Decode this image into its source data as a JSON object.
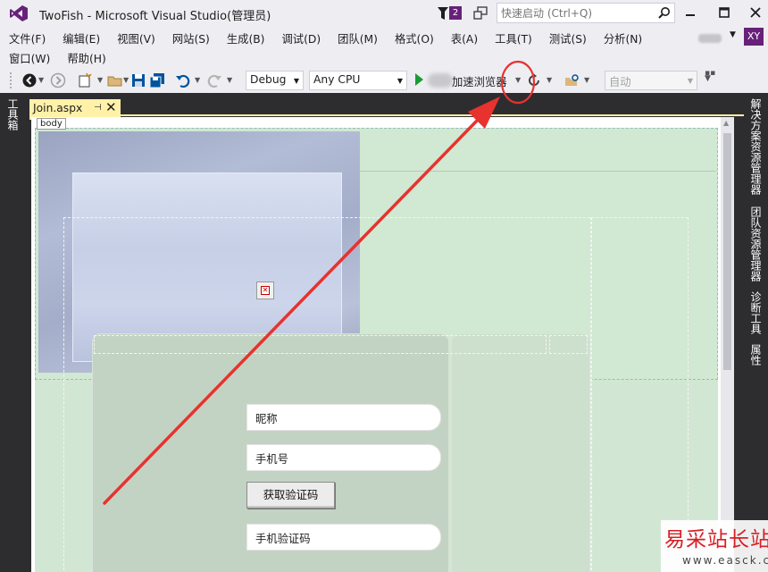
{
  "window": {
    "title": "TwoFish - Microsoft Visual Studio(管理员)",
    "notification_count": "2",
    "quick_launch_placeholder": "快速启动 (Ctrl+Q)",
    "user_initials": "XY"
  },
  "menu": {
    "row1": [
      "文件(F)",
      "编辑(E)",
      "视图(V)",
      "网站(S)",
      "生成(B)",
      "调试(D)",
      "团队(M)",
      "格式(O)",
      "表(A)",
      "工具(T)",
      "测试(S)",
      "分析(N)"
    ],
    "row2": [
      "窗口(W)",
      "帮助(H)"
    ]
  },
  "toolbar": {
    "config": "Debug",
    "platform": "Any CPU",
    "start_label": "加速浏览器",
    "disabled_combo": "自动"
  },
  "left_dock": {
    "toolbox": "工具箱"
  },
  "right_dock": {
    "tabs": [
      "解决方案资源管理器",
      "团队资源管理器",
      "诊断工具",
      "属性"
    ]
  },
  "editor": {
    "tab_title": "Join.aspx",
    "breadcrumb_tag": "body"
  },
  "form": {
    "nickname": "昵称",
    "phone": "手机号",
    "get_code_button": "获取验证码",
    "code": "手机验证码"
  },
  "watermark": {
    "main": "易采站长站",
    "sub": "www.easck.com"
  },
  "colors": {
    "accent": "#68217a",
    "active_tab": "#fff1a8",
    "annotation": "#e8322e",
    "design_bg": "#d1e8d2",
    "dock_bg": "#2d2d30"
  }
}
